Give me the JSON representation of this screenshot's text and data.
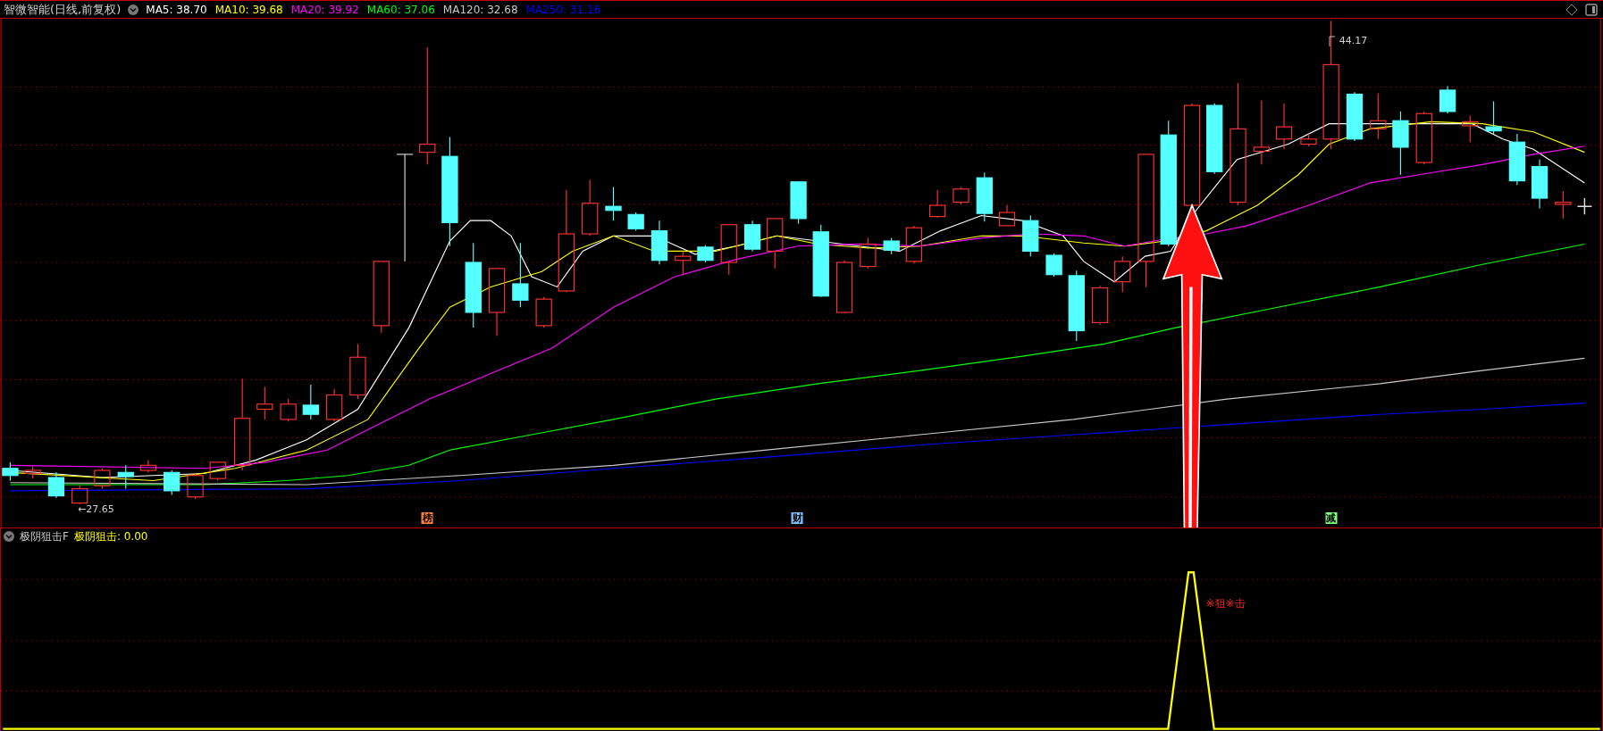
{
  "header": {
    "title": "智微智能(日线,前复权)",
    "ma_readings": [
      {
        "text": "MA5: 38.70",
        "color": "#ffffff"
      },
      {
        "text": "MA10: 39.68",
        "color": "#ffff00"
      },
      {
        "text": "MA20: 39.92",
        "color": "#ff00ff"
      },
      {
        "text": "MA60: 37.06",
        "color": "#00ff00"
      },
      {
        "text": "MA120: 32.68",
        "color": "#c8c8c8"
      },
      {
        "text": "MA250: 31.16",
        "color": "#0000ff"
      }
    ]
  },
  "price_chart": {
    "high_label": "44.17",
    "low_label": "←27.65",
    "signals": [
      {
        "text": "榜",
        "color": "#ff8040"
      },
      {
        "text": "财",
        "color": "#80c0ff"
      },
      {
        "text": "减",
        "color": "#80ff80"
      }
    ]
  },
  "indicator": {
    "name": "极阴狙击F",
    "reading": "极阴狙击: 0.00",
    "signal_text": "※狙※击"
  }
}
